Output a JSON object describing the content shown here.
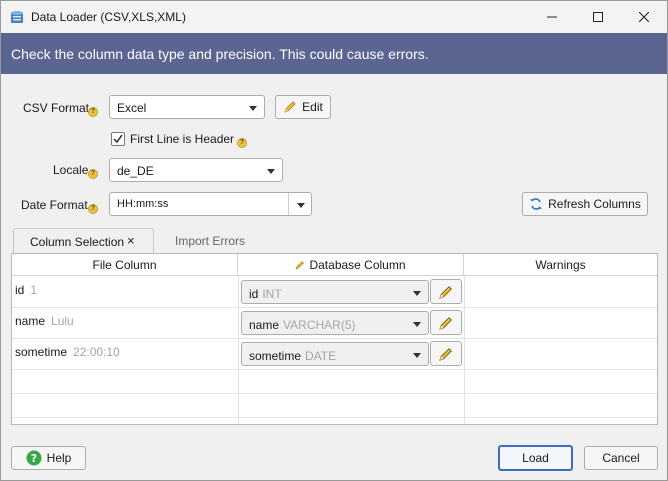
{
  "window": {
    "title": "Data Loader (CSV,XLS,XML)"
  },
  "banner": {
    "message": "Check the column data type and precision. This could cause errors."
  },
  "form": {
    "csv_format_label": "CSV Format",
    "csv_format_value": "Excel",
    "edit_label": "Edit",
    "first_line_header_label": "First Line is Header",
    "first_line_header_checked": true,
    "locale_label": "Locale",
    "locale_value": "de_DE",
    "date_format_label": "Date Format",
    "date_format_value": "HH:mm:ss",
    "refresh_label": "Refresh Columns"
  },
  "tabs": [
    {
      "label": "Column Selection",
      "active": true
    },
    {
      "label": "Import Errors",
      "active": false
    }
  ],
  "grid": {
    "headers": [
      "File Column",
      "Database Column",
      "Warnings"
    ],
    "rows": [
      {
        "file_column": "id",
        "sample": "1",
        "db_column": "id",
        "db_type": "INT",
        "warning": ""
      },
      {
        "file_column": "name",
        "sample": "Lulu",
        "db_column": "name",
        "db_type": "VARCHAR(5)",
        "warning": ""
      },
      {
        "file_column": "sometime",
        "sample": "22:00:10",
        "db_column": "sometime",
        "db_type": "DATE",
        "warning": ""
      }
    ]
  },
  "footer": {
    "help_label": "Help",
    "load_label": "Load",
    "cancel_label": "Cancel"
  },
  "colors": {
    "banner": "#5b6591",
    "help_icon": "#3aa64a",
    "default_button_border": "#3d6fb6"
  }
}
